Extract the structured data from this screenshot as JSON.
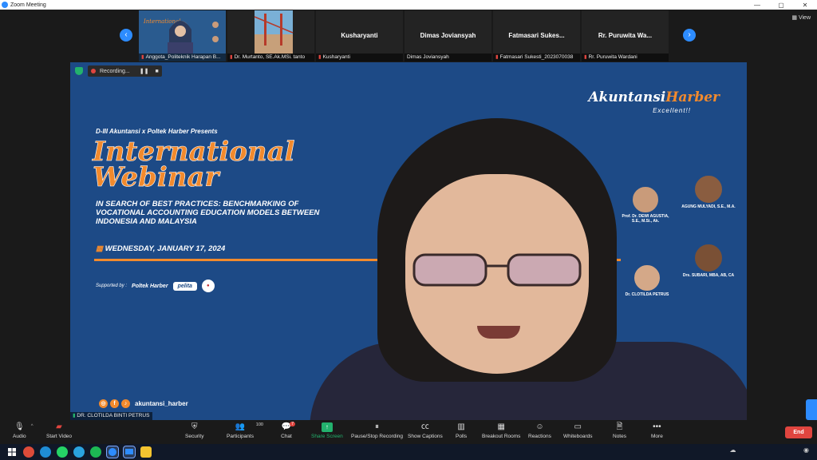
{
  "window": {
    "title": "Zoom Meeting",
    "controls": [
      "—",
      "▢",
      "✕"
    ]
  },
  "view_label": "View",
  "gallery": [
    {
      "label": "Anggota_Politeknik Harapan B...",
      "muted": true
    },
    {
      "label": "Dr. Murtanto, SE.Ak.MSi. tanto",
      "muted": true
    },
    {
      "name": "Kusharyanti",
      "label": "Kusharyanti",
      "muted": true
    },
    {
      "name": "Dimas Joviansyah",
      "label": "Dimas Joviansyah",
      "muted": false
    },
    {
      "name": "Fatmasari Sukes...",
      "label": "Fatmasari Sukesti_2023070038",
      "muted": true
    },
    {
      "name": "Rr. Puruwita Wa...",
      "label": "Rr. Puruwita Wardani",
      "muted": true
    }
  ],
  "recording": {
    "label": "Recording..."
  },
  "slide": {
    "brand_main": "Akuntansi",
    "brand_accent": "Harber",
    "brand_sub": "Excellent!!",
    "presents": "D-III Akuntansi x Poltek Harber Presents",
    "title_line1": "International",
    "title_line2": "Webinar",
    "subtitle": "IN SEARCH OF BEST PRACTICES: BENCHMARKING OF VOCATIONAL ACCOUNTING EDUCATION MODELS BETWEEN INDONESIA AND MALAYSIA",
    "date": "WEDNESDAY, JANUARY 17, 2024",
    "supported_by": "Supported by :",
    "logos": [
      "Poltek Harber",
      "pelita"
    ],
    "social_handle": "akuntansi_harber",
    "speakers": [
      {
        "name": "Prof. Dr. DEWI AGUSTIA, S.E., M.Si., Ak."
      },
      {
        "name": "AGUNG MULYADI, S.E., M.A."
      },
      {
        "name": "Drs. SUBARI, MBA, AB, CA"
      },
      {
        "name": "Dr. CLOTILDA PETRUS"
      }
    ]
  },
  "active_speaker": {
    "name": "DR. CLOTILDA BINTI PETRUS"
  },
  "toolbar": {
    "audio": "Audio",
    "video": "Start Video",
    "security": "Security",
    "participants": "Participants",
    "participants_count": "100",
    "chat": "Chat",
    "chat_badge": "7",
    "share": "Share Screen",
    "record": "Pause/Stop Recording",
    "captions": "Show Captions",
    "polls": "Polls",
    "breakout": "Breakout Rooms",
    "reactions": "Reactions",
    "whiteboards": "Whiteboards",
    "notes": "Notes",
    "more": "More",
    "end": "End"
  },
  "colors": {
    "accent": "#2d8cff",
    "slide_blue": "#1d4a86",
    "orange": "#f28a2d",
    "end_red": "#e0453f",
    "share_green": "#23b26d"
  }
}
